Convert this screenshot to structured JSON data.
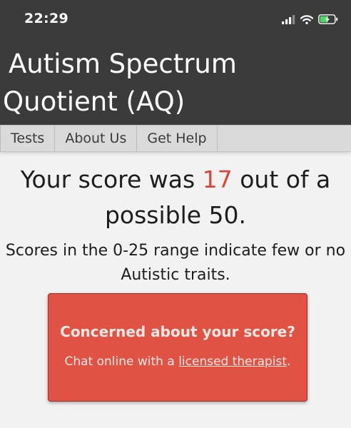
{
  "status_bar": {
    "time": "22:29",
    "icons": [
      "cellular-signal-icon",
      "wifi-icon",
      "battery-charging-icon"
    ],
    "battery_color": "#4cd964"
  },
  "header": {
    "title": "Autism Spectrum Quotient (AQ)"
  },
  "nav": {
    "items": [
      {
        "label": "Tests"
      },
      {
        "label": "About Us"
      },
      {
        "label": "Get Help"
      }
    ]
  },
  "result": {
    "prefix": "Your score was",
    "score": "17",
    "suffix": "out of a possible 50.",
    "description": "Scores in the 0-25 range indicate few or no Autistic traits."
  },
  "cta": {
    "title": "Concerned about your score?",
    "text_before": "Chat online with a",
    "link_text": "licensed therapist",
    "text_after": "."
  },
  "colors": {
    "header_bg": "#3b3b3b",
    "score_accent": "#d9473b",
    "cta_bg": "#e05244"
  }
}
